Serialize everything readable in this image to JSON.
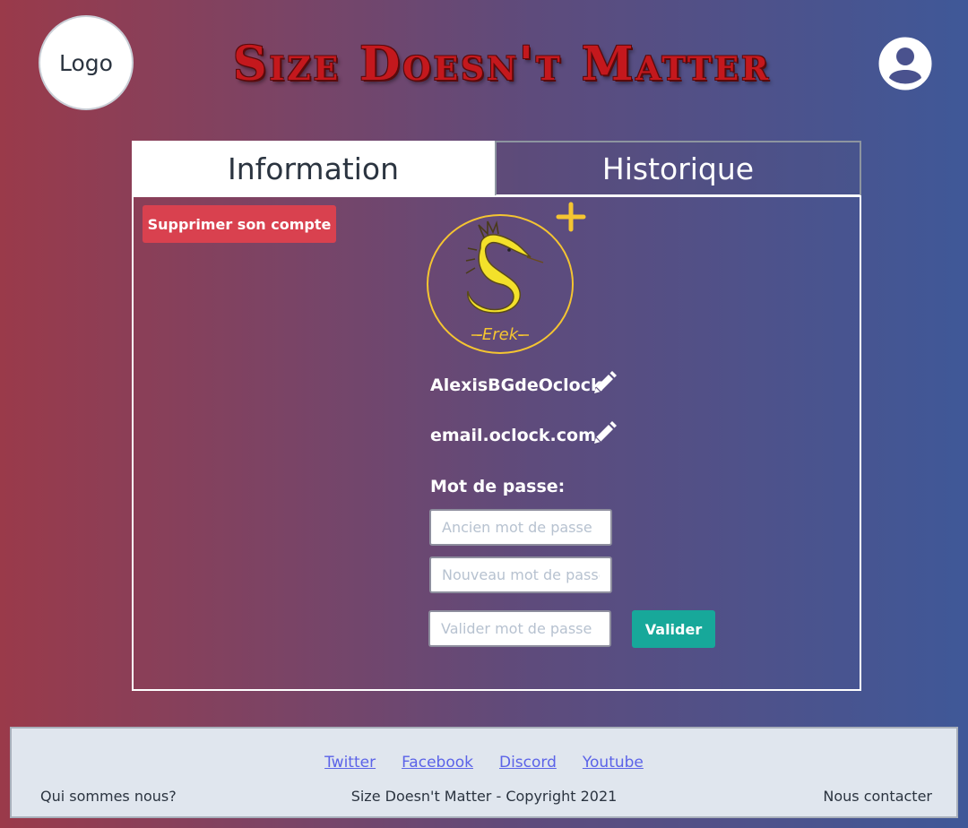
{
  "header": {
    "logo_text": "Logo",
    "site_title": "Size Doesn't Matter",
    "user_icon": "user-avatar-icon"
  },
  "tabs": [
    {
      "label": "Information",
      "active": true
    },
    {
      "label": "Historique",
      "active": false
    }
  ],
  "profile": {
    "delete_button": "Supprimer son compte",
    "avatar_caption": "-Erek-",
    "add_avatar_icon": "plus-icon",
    "username": "AlexisBGdeOclock",
    "email": "email.oclock.com",
    "edit_icon": "pencil-icon",
    "password_label": "Mot de passe:",
    "old_password_placeholder": "Ancien mot de passe",
    "new_password_placeholder": "Nouveau mot de passe",
    "confirm_password_placeholder": "Valider mot de passe",
    "validate_button": "Valider"
  },
  "footer": {
    "links": [
      "Twitter",
      "Facebook",
      "Discord",
      "Youtube"
    ],
    "about": "Qui sommes nous?",
    "copyright": "Size Doesn't Matter - Copyright 2021",
    "contact": "Nous contacter"
  },
  "colors": {
    "accent_yellow": "#f5c531",
    "delete_red": "#d9414f",
    "validate_teal": "#17a89a",
    "title_red": "#c4181d",
    "link_blue": "#5b63e8"
  }
}
